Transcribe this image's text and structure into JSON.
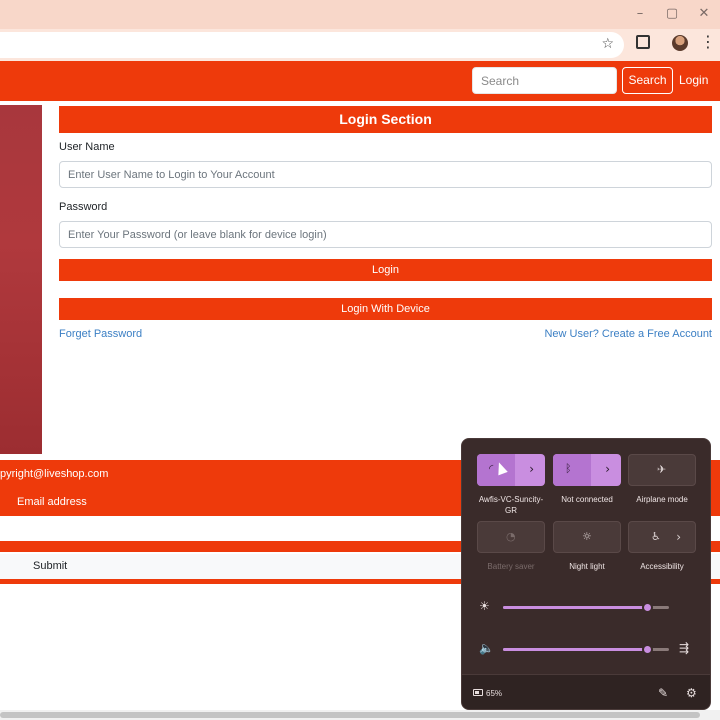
{
  "browser": {
    "window_controls": {
      "minimize": "–",
      "maximize": "▢",
      "close": "✕"
    },
    "bookmark_icon": "star-icon",
    "extensions_icon": "puzzle-icon",
    "menu": "⋮"
  },
  "navbar": {
    "search_placeholder": "Search",
    "search_button": "Search",
    "login_link": "Login"
  },
  "login": {
    "title": "Login Section",
    "username_label": "User Name",
    "username_placeholder": "Enter User Name to Login to Your Account",
    "password_label": "Password",
    "password_placeholder": "Enter Your Password (or leave blank for device login)",
    "login_button": "Login",
    "device_button": "Login With Device",
    "forget_link": "Forget Password",
    "new_user_link": "New User? Create a Free Account"
  },
  "footer": {
    "copyright": "pyright@liveshop.com",
    "email_label": "Email address",
    "submit_button": "Submit"
  },
  "quick_settings": {
    "tiles": [
      {
        "label": "Awfis-VC-Suncity-GR",
        "icon": "wifi-icon",
        "active": true
      },
      {
        "label": "Not connected",
        "icon": "bluetooth-icon",
        "active": true
      },
      {
        "label": "Airplane mode",
        "icon": "airplane-icon",
        "active": false
      },
      {
        "label": "Battery saver",
        "icon": "battery-saver-icon",
        "active": false,
        "disabled": true
      },
      {
        "label": "Night light",
        "icon": "night-light-icon",
        "active": false
      },
      {
        "label": "Accessibility",
        "icon": "accessibility-icon",
        "active": false
      }
    ],
    "brightness_percent": 87,
    "volume_percent": 87,
    "battery": "65%",
    "accent_color": "#c98ee0"
  },
  "colors": {
    "brand": "#ee3a0b",
    "link": "#3b7fc4"
  }
}
